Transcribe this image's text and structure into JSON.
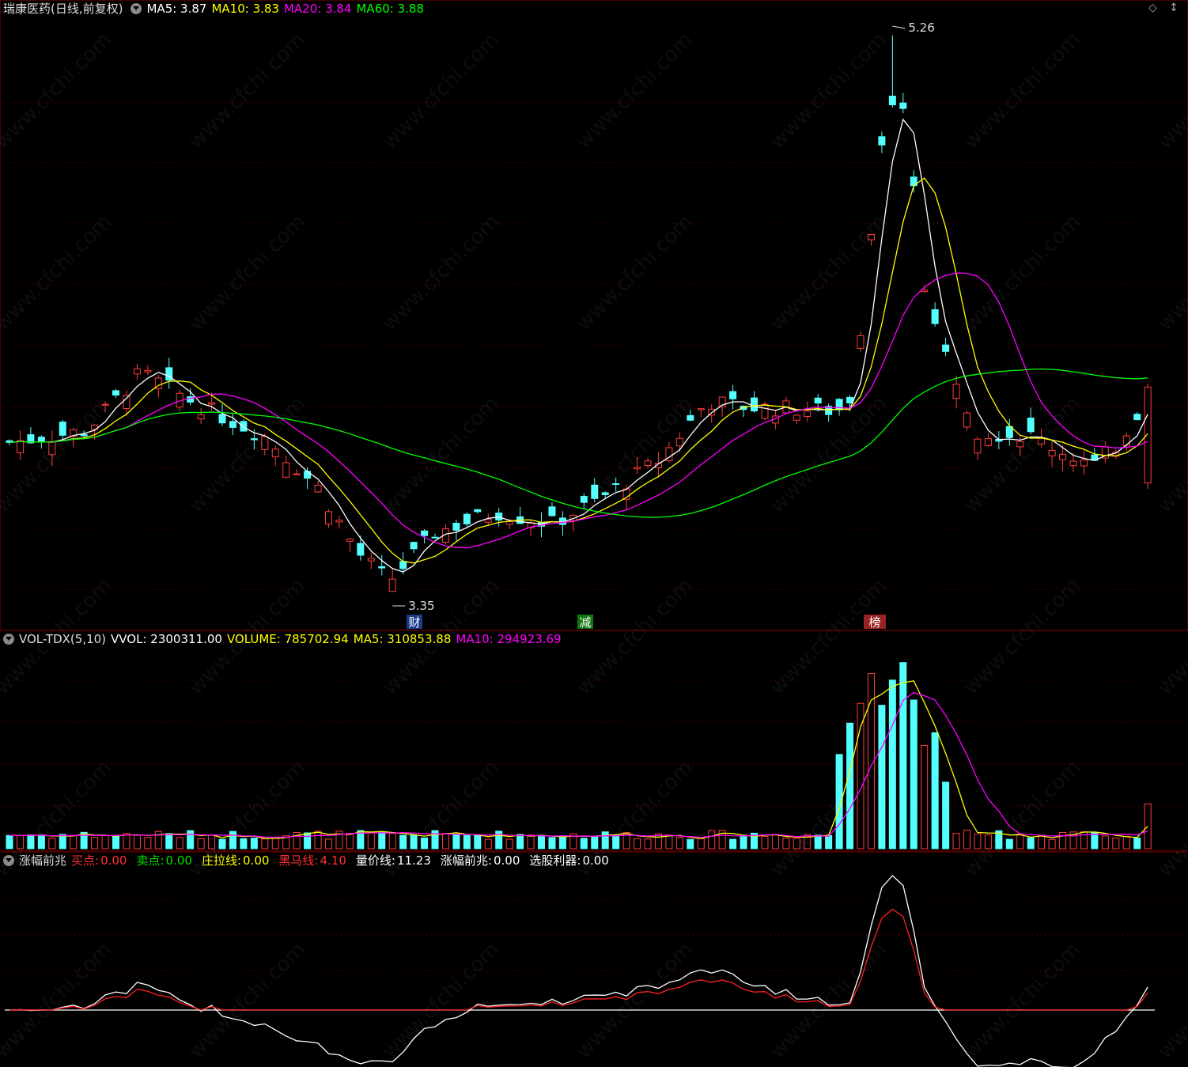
{
  "main": {
    "title": "瑞康医药(日线,前复权)",
    "indicators": [
      {
        "label": "MA5: 3.87",
        "color": "#ffffff"
      },
      {
        "label": "MA10: 3.83",
        "color": "#ffff00"
      },
      {
        "label": "MA20: 3.84",
        "color": "#ff00ff"
      },
      {
        "label": "MA60: 3.88",
        "color": "#00ff00"
      }
    ],
    "high_label": "5.26",
    "low_label": "3.35",
    "markers": [
      {
        "text": "财",
        "bg": "#1c3a8a"
      },
      {
        "text": "减",
        "bg": "#117711"
      },
      {
        "text": "榜",
        "bg": "#992222"
      }
    ],
    "controls": [
      "◇",
      "↕"
    ]
  },
  "volume": {
    "title": "VOL-TDX(5,10)",
    "indicators": [
      {
        "label": "VVOL: 2300311.00",
        "color": "#ffffff"
      },
      {
        "label": "VOLUME: 785702.94",
        "color": "#ffff00"
      },
      {
        "label": "MA5: 310853.88",
        "color": "#ffff00"
      },
      {
        "label": "MA10: 294923.69",
        "color": "#ff00ff"
      }
    ]
  },
  "indicator": {
    "title": "涨幅前兆",
    "indicators": [
      {
        "label": "买点:",
        "value": "0.00",
        "color": "#ff3030",
        "labelColor": "#ff3030"
      },
      {
        "label": "卖点:",
        "value": "0.00",
        "color": "#00dd00",
        "labelColor": "#00dd00"
      },
      {
        "label": "庄拉线:",
        "value": "0.00",
        "color": "#ffff00",
        "labelColor": "#ffff00"
      },
      {
        "label": "黑马线:",
        "value": "4.10",
        "color": "#ff3030",
        "labelColor": "#ff3030"
      },
      {
        "label": "量价线:",
        "value": "11.23",
        "color": "#ffffff",
        "labelColor": "#ffffff"
      },
      {
        "label": "涨幅前兆:",
        "value": "0.00",
        "color": "#ffffff",
        "labelColor": "#ffffff"
      },
      {
        "label": "选股利器:",
        "value": "0.00",
        "color": "#ffffff",
        "labelColor": "#ffffff"
      }
    ]
  },
  "watermark": "www.cfchi.com",
  "chart_data": {
    "type": "candlestick",
    "price_range": [
      3.35,
      5.26
    ],
    "ma_lines": [
      "MA5",
      "MA10",
      "MA20",
      "MA60"
    ],
    "last_values": {
      "MA5": 3.87,
      "MA10": 3.83,
      "MA20": 3.84,
      "MA60": 3.88
    },
    "volume_last": {
      "VVOL": 2300311.0,
      "VOLUME": 785702.94,
      "MA5": 310853.88,
      "MA10": 294923.69
    }
  }
}
